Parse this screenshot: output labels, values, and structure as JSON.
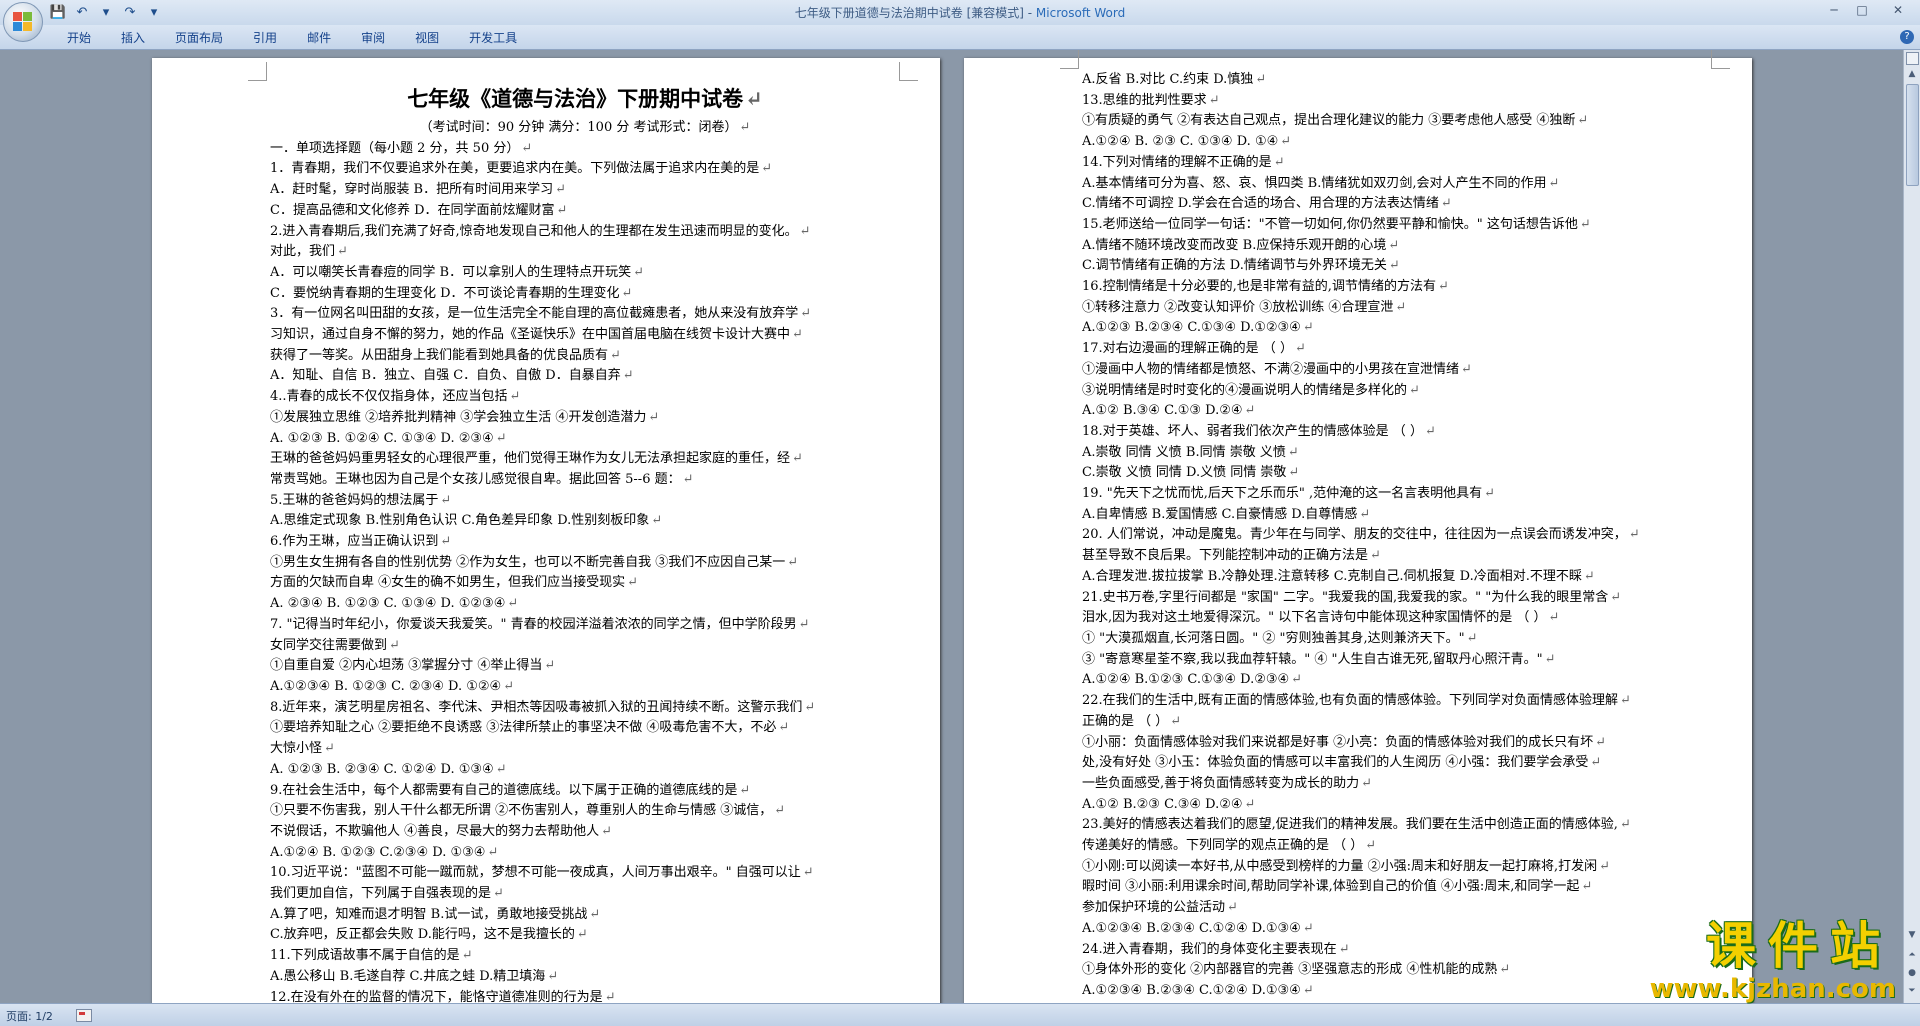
{
  "window": {
    "title": "七年级下册道德与法治期中试卷 [兼容模式] - ",
    "app": "Microsoft Word"
  },
  "quick_access": [
    {
      "name": "save-icon",
      "glyph": "💾"
    },
    {
      "name": "undo-icon",
      "glyph": "↶"
    },
    {
      "name": "undo-dropdown-icon",
      "glyph": "▾"
    },
    {
      "name": "redo-icon",
      "glyph": "↷"
    },
    {
      "name": "customize-qat-icon",
      "glyph": "▾"
    }
  ],
  "window_controls": {
    "minimize": "─",
    "maximize": "□",
    "close": "✕"
  },
  "ribbon": {
    "tabs": [
      "开始",
      "插入",
      "页面布局",
      "引用",
      "邮件",
      "审阅",
      "视图",
      "开发工具"
    ],
    "help": "?"
  },
  "page1": {
    "lines": [
      {
        "t": "七年级《道德与法治》下册期中试卷",
        "c": "title"
      },
      {
        "t": "（考试时间：90 分钟   满分：100 分   考试形式：闭卷）",
        "c": "center"
      },
      {
        "t": "一．单项选择题（每小题 2 分，共 50 分）"
      },
      {
        "t": "1．青春期，我们不仅要追求外在美，更要追求内在美。下列做法属于追求内在美的是"
      },
      {
        "t": "A．赶时髦，穿时尚服装              B．把所有时间用来学习"
      },
      {
        "t": "C．提高品德和文化修养              D．在同学面前炫耀财富"
      },
      {
        "t": "2.进入青春期后,我们充满了好奇,惊奇地发现自己和他人的生理都在发生迅速而明显的变化。"
      },
      {
        "t": "对此，我们"
      },
      {
        "t": "A．可以嘲笑长青春痘的同学          B．可以拿别人的生理特点开玩笑"
      },
      {
        "t": "C．要悦纳青春期的生理变化          D．不可谈论青春期的生理变化"
      },
      {
        "t": "3．有一位网名叫田甜的女孩，是一位生活完全不能自理的高位截瘫患者，她从来没有放弃学"
      },
      {
        "t": "习知识，通过自身不懈的努力，她的作品《圣诞快乐》在中国首届电脑在线贺卡设计大赛中"
      },
      {
        "t": "获得了一等奖。从田甜身上我们能看到她具备的优良品质有"
      },
      {
        "t": "A．知耻、自信          B．独立、自强          C．自负、自傲          D．自暴自弃"
      },
      {
        "t": "4..青春的成长不仅仅指身体，还应当包括"
      },
      {
        "t": "①发展独立思维   ②培养批判精神   ③学会独立生活    ④开发创造潜力"
      },
      {
        "t": "A. ①②③          B. ①②④          C. ①③④           D. ②③④"
      },
      {
        "t": "王琳的爸爸妈妈重男轻女的心理很严重，他们觉得王琳作为女儿无法承担起家庭的重任，经"
      },
      {
        "t": "常责骂她。王琳也因为自己是个女孩儿感觉很自卑。据此回答 5--6 题："
      },
      {
        "t": "5.王琳的爸爸妈妈的想法属于"
      },
      {
        "t": "A.思维定式现象         B.性别角色认识          C.角色差异印象          D.性别刻板印象"
      },
      {
        "t": "6.作为王琳，应当正确认识到"
      },
      {
        "t": "①男生女生拥有各自的性别优势  ②作为女生，也可以不断完善自我   ③我们不应因自己某一"
      },
      {
        "t": "方面的欠缺而自卑   ④女生的确不如男生，但我们应当接受现实"
      },
      {
        "t": "A. ②③④          B. ①②③          C. ①③④           D. ①②③④"
      },
      {
        "t": "7. \"记得当时年纪小，你爱谈天我爱笑。\" 青春的校园洋溢着浓浓的同学之情，但中学阶段男"
      },
      {
        "t": "女同学交往需要做到"
      },
      {
        "t": "①自重自爱       ②内心坦荡        ③掌握分寸        ④举止得当"
      },
      {
        "t": "A.①②③④        B. ①②③          C. ②③④           D. ①②④"
      },
      {
        "t": "8.近年来，演艺明星房祖名、李代沫、尹相杰等因吸毒被抓入狱的丑闻持续不断。这警示我们"
      },
      {
        "t": "①要培养知耻之心   ②要拒绝不良诱惑   ③法律所禁止的事坚决不做   ④吸毒危害不大，不必"
      },
      {
        "t": "大惊小怪"
      },
      {
        "t": "A. ①②③          B. ②③④          C. ①②④           D. ①③④"
      },
      {
        "t": "9.在社会生活中，每个人都需要有自己的道德底线。以下属于正确的道德底线的是"
      },
      {
        "t": "①只要不伤害我，别人干什么都无所谓   ②不伤害别人，尊重别人的生命与情感   ③诚信，"
      },
      {
        "t": "不说假话，不欺骗他人   ④善良，尽最大的努力去帮助他人"
      },
      {
        "t": "A.①②④          B. ①②③          C.②③④           D. ①③④"
      },
      {
        "t": "10.习近平说：\"蓝图不可能一蹴而就，梦想不可能一夜成真，人间万事出艰辛。\" 自强可以让"
      },
      {
        "t": "我们更加自信，下列属于自强表现的是"
      },
      {
        "t": "A.算了吧，知难而退才明智            B.试一试，勇敢地接受挑战"
      },
      {
        "t": "C.放弃吧，反正都会失败              D.能行吗，这不是我擅长的"
      },
      {
        "t": "11.下列成语故事不属于自信的是"
      },
      {
        "t": "A.愚公移山          B.毛遂自荐          C.井底之蛙          D.精卫填海"
      },
      {
        "t": "12.在没有外在的监督的情况下，能恪守道德准则的行为是"
      }
    ]
  },
  "page2": {
    "lines": [
      {
        "t": "A.反省                B.对比              C.约束                D.慎独"
      },
      {
        "t": "13.思维的批判性要求"
      },
      {
        "t": "①有质疑的勇气   ②有表达自己观点，提出合理化建议的能力   ③要考虑他人感受     ④独断"
      },
      {
        "t": "A.①②④            B. ②③            C. ①③④            D. ①④"
      },
      {
        "t": "14.下列对情绪的理解不正确的是"
      },
      {
        "t": "A.基本情绪可分为喜、怒、哀、惧四类            B.情绪犹如双刃剑,会对人产生不同的作用"
      },
      {
        "t": "C.情绪不可调控                               D.学会在合适的场合、用合理的方法表达情绪"
      },
      {
        "t": "15.老师送给一位同学一句话：\"不管一切如何,你仍然要平静和愉快。\" 这句话想告诉他"
      },
      {
        "t": "A.情绪不随环境改变而改变                     B.应保持乐观开朗的心境"
      },
      {
        "t": "C.调节情绪有正确的方法                       D.情绪调节与外界环境无关"
      },
      {
        "t": "16.控制情绪是十分必要的,也是非常有益的,调节情绪的方法有"
      },
      {
        "t": "①转移注意力       ②改变认知评价       ③放松训练           ④合理宣泄"
      },
      {
        "t": "A.①②③              B.②③④              C.①③④                D.①②③④"
      },
      {
        "t": "17.对右边漫画的理解正确的是  （      ）"
      },
      {
        "t": "①漫画中人物的情绪都是愤怒、不满②漫画中的小男孩在宣泄情绪"
      },
      {
        "t": "③说明情绪是时时变化的④漫画说明人的情绪是多样化的"
      },
      {
        "t": "A.①②                B.③④              C.①③                 D.②④"
      },
      {
        "t": "18.对于英雄、坏人、弱者我们依次产生的情感体验是   （      ）"
      },
      {
        "t": "A.崇敬   同情    义愤                         B.同情   崇敬   义愤"
      },
      {
        "t": "C.崇敬   义愤    同情                         D.义愤   同情   崇敬"
      },
      {
        "t": "19. \"先天下之忧而忧,后天下之乐而乐\" ,范仲淹的这一名言表明他具有"
      },
      {
        "t": "A.自卑情感          B.爱国情感          C.自豪情感                D.自尊情感"
      },
      {
        "t": "20. 人们常说，冲动是魔鬼。青少年在与同学、朋友的交往中，往往因为一点误会而诱发冲突，"
      },
      {
        "t": "甚至导致不良后果。下列能控制冲动的正确方法是"
      },
      {
        "t": "A.合理发泄.拔拉拔掌    B.冷静处理.注意转移       C.克制自己.伺机报复  D.冷面相对.不理不睬"
      },
      {
        "t": "21.史书万卷,字里行间都是 \"家国\" 二字。\"我爱我的国,我爱我的家。\" \"为什么我的眼里常含"
      },
      {
        "t": "泪水,因为我对这土地爱得深沉。\" 以下名言诗句中能体现这种家国情怀的是   （      ）"
      },
      {
        "t": "① \"大漠孤烟直,长河落日圆。\" ② \"穷则独善其身,达则兼济天下。\""
      },
      {
        "t": "③ \"寄意寒星荃不察,我以我血荐轩辕。\" ④ \"人生自古谁无死,留取丹心照汗青。\""
      },
      {
        "t": "A.①②④          B.①②③                C.①③④                    D.②③④"
      },
      {
        "t": "22.在我们的生活中,既有正面的情感体验,也有负面的情感体验。下列同学对负面情感体验理解"
      },
      {
        "t": "正确的是  （      ）"
      },
      {
        "t": "①小丽：负面情感体验对我们来说都是好事     ②小亮：负面的情感体验对我们的成长只有坏"
      },
      {
        "t": "处,没有好处    ③小玉：体验负面的情感可以丰富我们的人生阅历    ④小强：我们要学会承受"
      },
      {
        "t": "一些负面感受,善于将负面情感转变为成长的助力"
      },
      {
        "t": "A.①②              B.②③              C.③④              D.②④"
      },
      {
        "t": "23.美好的情感表达着我们的愿望,促进我们的精神发展。我们要在生活中创造正面的情感体验,"
      },
      {
        "t": "传递美好的情感。下列同学的观点正确的是   （      ）"
      },
      {
        "t": "①小刚:可以阅读一本好书,从中感受到榜样的力量     ②小强:周末和好朋友一起打麻将,打发闲"
      },
      {
        "t": "暇时间     ③小丽:利用课余时间,帮助同学补课,体验到自己的价值     ④小强:周末,和同学一起"
      },
      {
        "t": "参加保护环境的公益活动"
      },
      {
        "t": "A.①②③④           B.②③④           C.①②④                    D.①③④"
      },
      {
        "t": "24.进入青春期，我们的身体变化主要表现在"
      },
      {
        "t": "①身体外形的变化     ②内部器官的完善      ③坚强意志的形成     ④性机能的成熟"
      },
      {
        "t": "A.①②③④           B.②③④           C.①②④                    D.①③④"
      }
    ]
  },
  "status": {
    "page": "页面: 1/2"
  },
  "watermark": {
    "title": "课件站",
    "url": "www.kjzhan.com"
  },
  "colors": {
    "accent": "#15428b",
    "watermark_fill": "#f4d000",
    "watermark_outline": "#1a6b1a"
  }
}
